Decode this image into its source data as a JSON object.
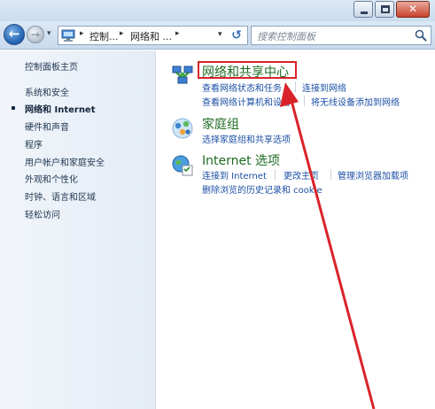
{
  "window": {
    "close_glyph": "✕"
  },
  "nav": {
    "back_glyph": "←",
    "forward_glyph": "→",
    "address_crumbs": [
      "控制...",
      "网络和 ..."
    ],
    "separator_glyph": "▸",
    "dropdown_glyph": "▾",
    "refresh_glyph": "↺"
  },
  "search": {
    "placeholder": "搜索控制面板"
  },
  "sidebar": {
    "items": [
      {
        "label": "控制面板主页",
        "current": false
      },
      {
        "label": "系统和安全",
        "current": false
      },
      {
        "label": "网络和 Internet",
        "current": true
      },
      {
        "label": "硬件和声音",
        "current": false
      },
      {
        "label": "程序",
        "current": false
      },
      {
        "label": "用户帐户和家庭安全",
        "current": false
      },
      {
        "label": "外观和个性化",
        "current": false
      },
      {
        "label": "时钟、语言和区域",
        "current": false
      },
      {
        "label": "轻松访问",
        "current": false
      }
    ]
  },
  "main": {
    "categories": [
      {
        "title": "网络和共享中心",
        "icon": "network-sharing-center-icon",
        "tasks": [
          "查看网络状态和任务",
          "连接到网络",
          "查看网络计算机和设备",
          "将无线设备添加到网络"
        ]
      },
      {
        "title": "家庭组",
        "icon": "homegroup-icon",
        "tasks": [
          "选择家庭组和共享选项"
        ]
      },
      {
        "title": "Internet 选项",
        "icon": "internet-options-icon",
        "tasks": [
          "连接到 Internet",
          "更改主页",
          "管理浏览器加载项",
          "删除浏览的历史记录和 cookie"
        ]
      }
    ]
  },
  "annotation": {
    "color": "#d9232a"
  }
}
